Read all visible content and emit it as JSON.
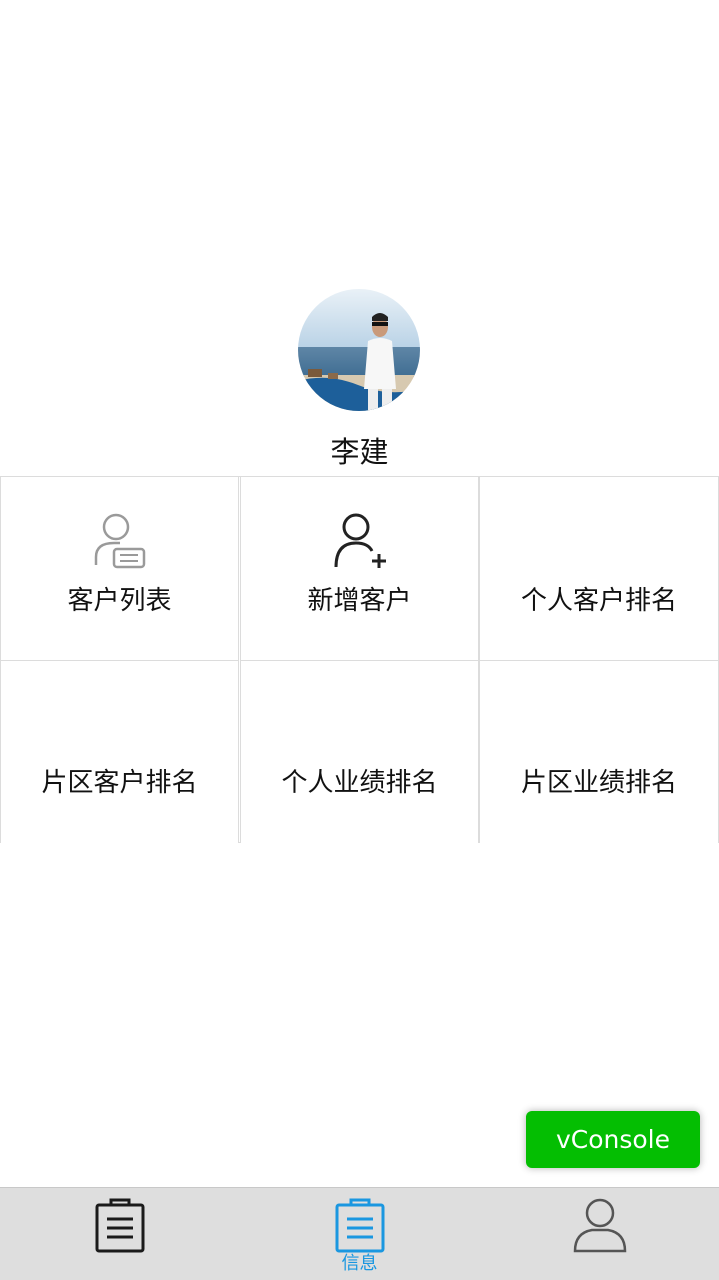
{
  "profile": {
    "name": "李建"
  },
  "menu": [
    {
      "label": "客户列表",
      "icon": "customer-list-icon"
    },
    {
      "label": "新增客户",
      "icon": "add-user-icon"
    },
    {
      "label": "个人客户排名",
      "icon": ""
    },
    {
      "label": "片区客户排名",
      "icon": ""
    },
    {
      "label": "个人业绩排名",
      "icon": ""
    },
    {
      "label": "片区业绩排名",
      "icon": ""
    }
  ],
  "vconsole": {
    "label": "vConsole",
    "color": "#04be02"
  },
  "tabbar": {
    "active_color": "#1a97e0",
    "tabs": [
      {
        "label": "",
        "icon": "clipboard-icon",
        "active": false
      },
      {
        "label": "信息",
        "icon": "clipboard-icon",
        "active": true
      },
      {
        "label": "",
        "icon": "user-icon",
        "active": false
      }
    ]
  }
}
